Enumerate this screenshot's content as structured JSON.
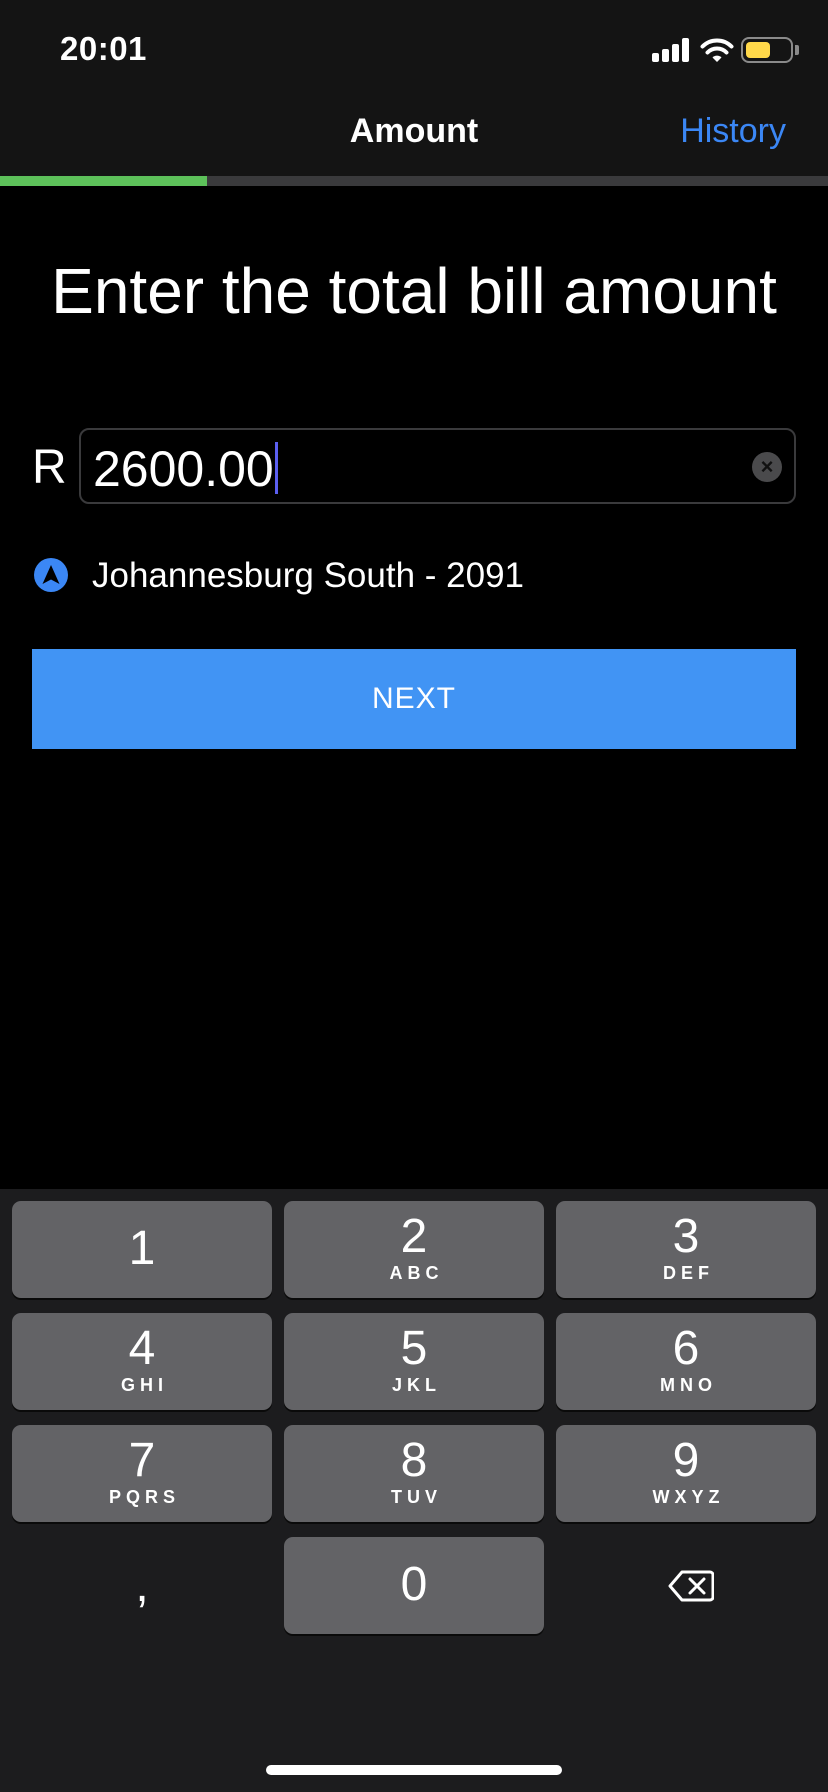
{
  "status_bar": {
    "time": "20:01"
  },
  "nav": {
    "title": "Amount",
    "history_link": "History"
  },
  "progress": {
    "fraction": 0.25,
    "color": "#5dc15a"
  },
  "main": {
    "headline": "Enter the total bill amount",
    "currency_symbol": "R",
    "amount_value": "2600.00",
    "location_text": "Johannesburg South - 2091",
    "next_label": "NEXT"
  },
  "keyboard": {
    "keys": [
      {
        "num": "1",
        "letters": ""
      },
      {
        "num": "2",
        "letters": "ABC"
      },
      {
        "num": "3",
        "letters": "DEF"
      },
      {
        "num": "4",
        "letters": "GHI"
      },
      {
        "num": "5",
        "letters": "JKL"
      },
      {
        "num": "6",
        "letters": "MNO"
      },
      {
        "num": "7",
        "letters": "PQRS"
      },
      {
        "num": "8",
        "letters": "TUV"
      },
      {
        "num": "9",
        "letters": "WXYZ"
      },
      {
        "num": "0",
        "letters": ""
      }
    ],
    "comma": ","
  },
  "colors": {
    "accent": "#3b87f5",
    "button": "#4194f4",
    "caret": "#5b5ff0",
    "battery": "#ffd84a"
  },
  "icons": {
    "location": "navigation-arrow-icon",
    "clear": "clear-circle-icon",
    "delete": "backspace-icon"
  }
}
